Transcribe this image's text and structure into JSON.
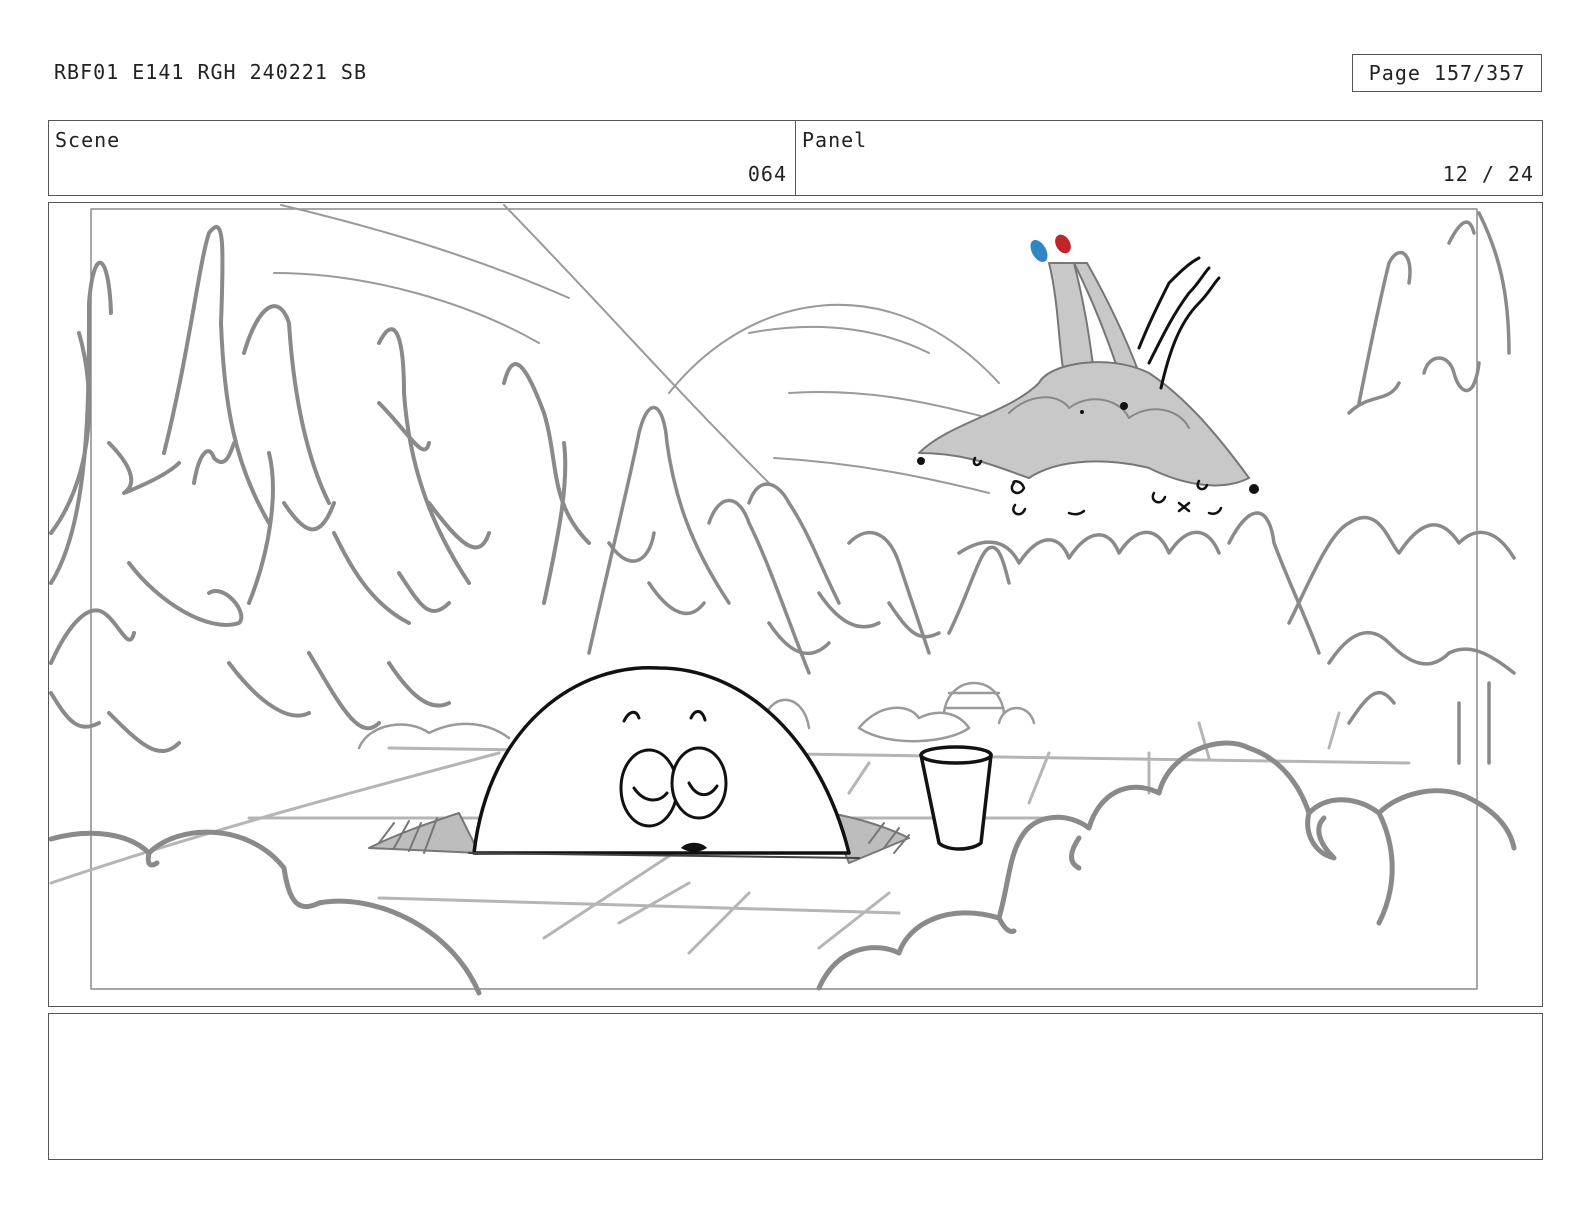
{
  "header": {
    "doc_id": "RBF01 E141 RGH 240221 SB",
    "page": "Page 157/357"
  },
  "info": {
    "scene_label": "Scene",
    "scene_value": "064",
    "panel_label": "Panel",
    "panel_value": "12 / 24"
  },
  "colors": {
    "sketch_gray": "#8a8a8a",
    "ink": "#111111",
    "creature_fill": "#c8c8c8",
    "antenna_blue": "#2f86c2",
    "antenna_red": "#c0252c"
  }
}
